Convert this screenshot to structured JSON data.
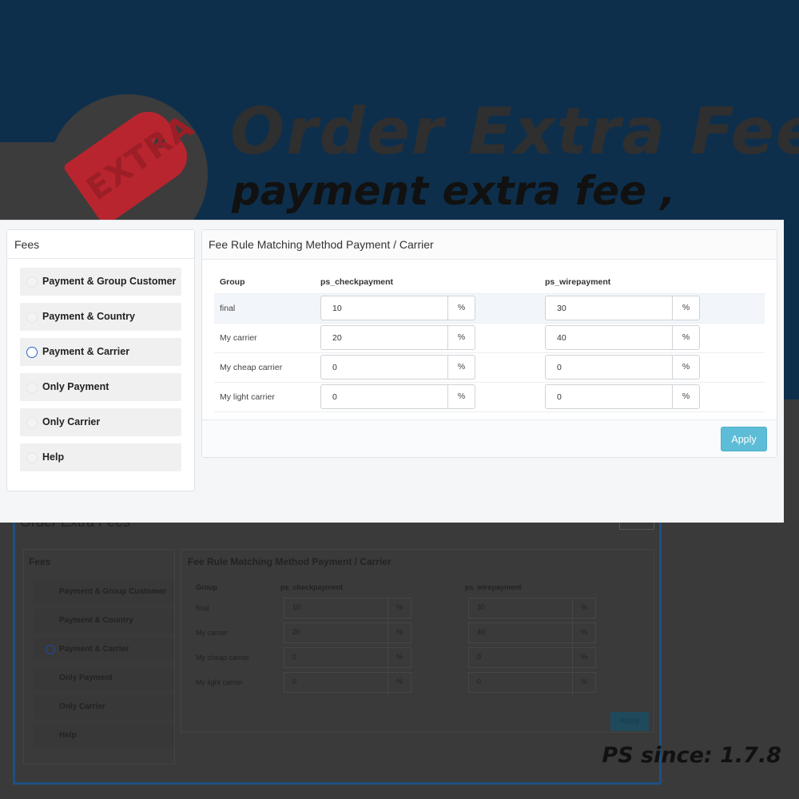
{
  "banner": {
    "title": "Order Extra Fees",
    "subtitle": "payment extra fee ,",
    "tag_text": "EXTRA",
    "version": "PS since: 1.7.8"
  },
  "ghost": {
    "title": "Order Extra Fees"
  },
  "fees_panel": {
    "title": "Fees",
    "items": [
      {
        "label": "Payment & Group Customer",
        "selected": false
      },
      {
        "label": "Payment & Country",
        "selected": false
      },
      {
        "label": "Payment & Carrier",
        "selected": true
      },
      {
        "label": "Only Payment",
        "selected": false
      },
      {
        "label": "Only Carrier",
        "selected": false
      },
      {
        "label": "Help",
        "selected": false
      }
    ]
  },
  "rule_panel": {
    "title": "Fee Rule Matching Method Payment / Carrier",
    "columns": [
      "Group",
      "ps_checkpayment",
      "ps_wirepayment"
    ],
    "unit": "%",
    "rows": [
      {
        "group": "final",
        "values": [
          "10",
          "30"
        ]
      },
      {
        "group": "My carrier",
        "values": [
          "20",
          "40"
        ]
      },
      {
        "group": "My cheap carrier",
        "values": [
          "0",
          "0"
        ]
      },
      {
        "group": "My light carrier",
        "values": [
          "0",
          "0"
        ]
      }
    ],
    "apply_label": "Apply"
  },
  "colors": {
    "banner_bg": "#0e2f4c",
    "accent_button": "#5dbcd6",
    "radio_selected": "#2a63c3",
    "tag_red": "#b9252f"
  }
}
